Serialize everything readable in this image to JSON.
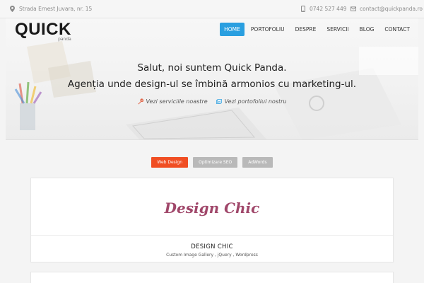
{
  "topbar": {
    "address": "Strada Ernest Juvara, nr. 15",
    "phone": "0742 527 449",
    "email": "contact@quickpanda.ro"
  },
  "logo": {
    "main": "QUICK",
    "sub": "panda"
  },
  "nav": {
    "items": [
      {
        "label": "HOME",
        "active": true
      },
      {
        "label": "PORTOFOLIU",
        "active": false
      },
      {
        "label": "DESPRE",
        "active": false
      },
      {
        "label": "SERVICII",
        "active": false
      },
      {
        "label": "BLOG",
        "active": false
      },
      {
        "label": "CONTACT",
        "active": false
      }
    ]
  },
  "hero": {
    "line1": "Salut, noi suntem Quick Panda.",
    "line2": "Agenția unde design-ul se îmbină armonios cu marketing-ul.",
    "link_services": "Vezi serviciile noastre",
    "link_portfolio": "Vezi portofoliul nostru"
  },
  "filters": [
    {
      "label": "Web Design",
      "active": true
    },
    {
      "label": "Optimizare SEO",
      "active": false
    },
    {
      "label": "AdWords",
      "active": false
    }
  ],
  "portfolio": {
    "script_title": "Design Chic",
    "title": "DESIGN CHIC",
    "subtitle": "Custom Image Gallery , jQuery , Wordpress"
  },
  "colors": {
    "accent_blue": "#2a9fe0",
    "accent_orange": "#f04e23",
    "script_pink": "#a0476a"
  }
}
